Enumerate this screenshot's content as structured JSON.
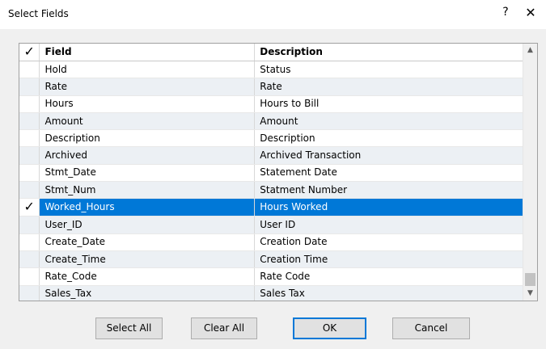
{
  "window": {
    "title": "Select Fields",
    "help_label": "?",
    "close_label": "✕"
  },
  "grid": {
    "columns": {
      "check": "✓",
      "field": "Field",
      "description": "Description"
    },
    "rows": [
      {
        "field": "Hold",
        "description": "Status",
        "checked": false
      },
      {
        "field": "Rate",
        "description": "Rate",
        "checked": false
      },
      {
        "field": "Hours",
        "description": "Hours to Bill",
        "checked": false
      },
      {
        "field": "Amount",
        "description": "Amount",
        "checked": false
      },
      {
        "field": "Description",
        "description": "Description",
        "checked": false
      },
      {
        "field": "Archived",
        "description": "Archived Transaction",
        "checked": false
      },
      {
        "field": "Stmt_Date",
        "description": "Statement Date",
        "checked": false
      },
      {
        "field": "Stmt_Num",
        "description": "Statment Number",
        "checked": false
      },
      {
        "field": "Worked_Hours",
        "description": "Hours Worked",
        "checked": true,
        "selected": true
      },
      {
        "field": "User_ID",
        "description": "User ID",
        "checked": false
      },
      {
        "field": "Create_Date",
        "description": "Creation Date",
        "checked": false
      },
      {
        "field": "Create_Time",
        "description": "Creation Time",
        "checked": false
      },
      {
        "field": "Rate_Code",
        "description": "Rate Code",
        "checked": false
      },
      {
        "field": "Sales_Tax",
        "description": "Sales Tax",
        "checked": false
      }
    ],
    "scroll_up_icon": "▲",
    "scroll_down_icon": "▼"
  },
  "buttons": {
    "select_all": "Select All",
    "clear_all": "Clear All",
    "ok": "OK",
    "cancel": "Cancel"
  },
  "colors": {
    "selection": "#0078d7",
    "alt_row": "#ecf0f4",
    "button_face": "#e1e1e1"
  }
}
